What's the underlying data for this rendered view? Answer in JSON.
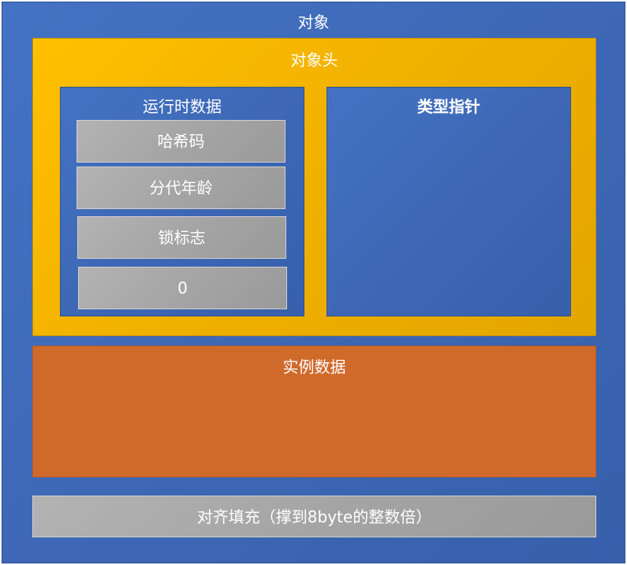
{
  "object": {
    "label": "对象"
  },
  "header": {
    "label": "对象头"
  },
  "runtime": {
    "label": "运行时数据",
    "items": [
      "哈希码",
      "分代年龄",
      "锁标志",
      "0"
    ]
  },
  "type_pointer": {
    "label": "类型指针"
  },
  "instance_data": {
    "label": "实例数据"
  },
  "padding": {
    "label": "对齐填充（撑到8byte的整数倍）"
  },
  "colors": {
    "object": "#4472c4",
    "header": "#ffc000",
    "instance_data": "#d06a2b",
    "cell": "#a5a5a5"
  }
}
